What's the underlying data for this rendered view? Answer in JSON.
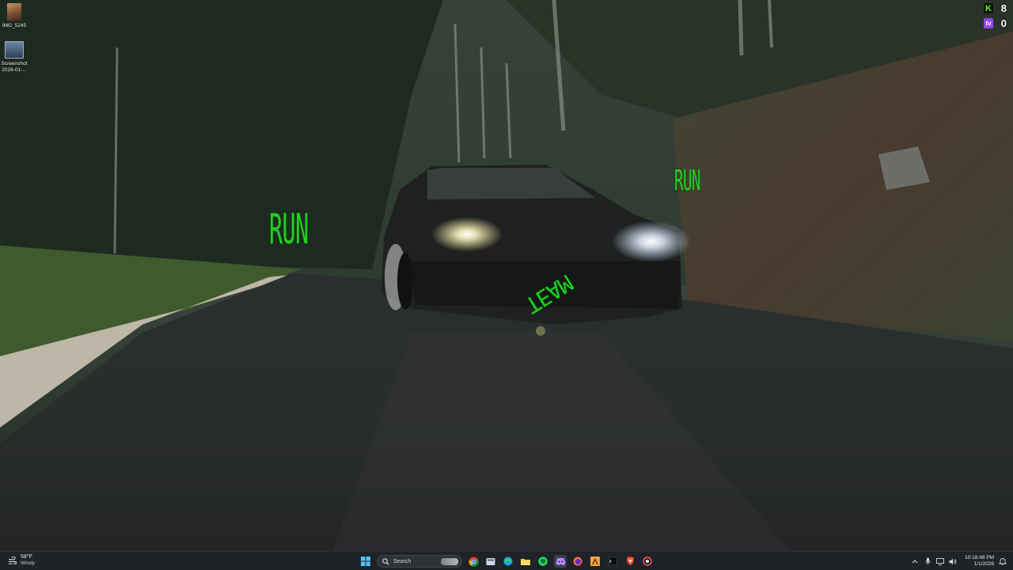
{
  "desktop": {
    "icons": [
      {
        "label": "IMG_5245",
        "icon": "image-file-icon"
      },
      {
        "label": "Screenshot 2026-01-...",
        "icon": "screenshot-file-icon"
      }
    ]
  },
  "overlay_text": {
    "run_left": "RUN",
    "run_right": "RUN",
    "team": "TEAM"
  },
  "counters": {
    "kick": {
      "badge": "K",
      "value": "8",
      "color": "#53fc18"
    },
    "twitch": {
      "badge": "tv",
      "value": "0",
      "color": "#9146ff"
    }
  },
  "taskbar": {
    "weather": {
      "temp": "58°F",
      "condition": "Windy"
    },
    "search": {
      "placeholder": "Search"
    },
    "apps": [
      "windows-start-icon",
      "search",
      "chrome-icon",
      "task-view-icon",
      "edge-icon",
      "file-explorer-icon",
      "spotify-icon",
      "discord-icon",
      "firefox-icon",
      "app-icon",
      "terminal-icon",
      "brave-icon",
      "snipping-icon"
    ],
    "clock": {
      "time": "10:18:48 PM",
      "date": "1/1/2026"
    }
  }
}
